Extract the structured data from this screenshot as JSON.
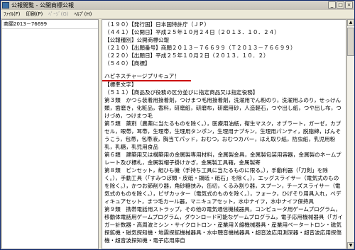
{
  "window": {
    "title": "公報閲覧 - 公開商標公報",
    "buttons": {
      "minimize": "_",
      "maximize": "□",
      "close": "×"
    }
  },
  "menubar": {
    "items": [
      {
        "label": "ﾌｧｲﾙ(F)",
        "disabled": false
      },
      {
        "label": "印刷(P)",
        "disabled": false
      },
      {
        "label": "ﾍﾟｰｼﾞ(G)",
        "disabled": true
      },
      {
        "label": "ﾍﾙﾌﾟ(H)",
        "disabled": false
      }
    ]
  },
  "sidebar": {
    "items": [
      {
        "label": "商願2013－76699"
      }
    ]
  },
  "content": {
    "lines": [
      "（１９０）【発行国】日本国特許庁（ＪＰ）",
      "（４４１）【公開日】平成２５年１０月２４日（２０１３．１０．２４）",
      "【公報種別】公開商標公報",
      "（２１０）【出願番号】商願２０１３－７６６９９（Ｔ２０１３－７６６９９）",
      "（２２０）【出願日】平成２５年１０月２日（２０１３．１０．２）",
      "（５４０）【商標】",
      "ハピネスチャージプリキュア！",
      "【標準文字】",
      "（５１１）【商品及び役務の区分並びに指定商品又は指定役務】",
      "第３類　かつら装着用接着剤，つけまつ毛用接着剤，洗濯用でん粉のり，洗濯用ふのり，せっけん類，歯磨き，化粧品，香料，研磨紙，研磨布，研磨用砂，人造軽石，つや出し紙，つや出し布，つけづめ，つけまつ毛",
      "第５類　薬剤（農薬に当たるものを除く。），医療用油紙，衛生マスク，オブラート，ガーゼ，カプセル，眼帯，耳帯，生理帯，生理用タンポン，生理用ナプキン，生理用パンティ，脱脂綿，ばんそうこう，包帯，包帯液，胸当てパッド，おむつ，おむつカバー，はえ取り紙，防虫紙，乳児用粉乳，乳糖，乳児用食品",
      "第６類　建築用又は構築用の金属製専用材料，金属製金具，金属製包装用容器，金属製のネームプレート及び標札，金属製帽子掛けかぎ，金属製工具箱，金属製寄",
      "第８類　ピンセット，組ひも機（手持ち工具に当たるものに限る。），手動利器（「刀剣」を除く。），手動工具（「すみつぼ類・皮砥・鋼砥・砥石」を除く。），エッグスライサー（電気式のものを除く。），かつお節削り器，角砂糖挟み，缶切，くるみ割り器，スプーン，チーズスライサー（電気式のものを除く。），ピザカッター（電気式のものを除く。），フォーク，ひげそり用具入れ，ペディキュアセット，まつ毛カール器，マニキュアセット，水中ナイフ，水中ナイフ保持具",
      "第９類　携帯電話用ストラップ，その他の電気通信機械器具，コンピュータ用ゲームプログラム，移動体電話用ゲームプログラム，ダウンロード可能なゲームプログラム，電子応用機械器具（「ガイガー計数器・高周波ミシン・サイクロトロン・産業用Ｘ線機械器具・産業用ベータートロン・磁気探鉱機・磁気探知機・地震探鉱機械器具・水中聴音機械器具・超音波応用測深器・超音波応用探傷機・超音波探知機・電子応用扉自"
    ]
  }
}
